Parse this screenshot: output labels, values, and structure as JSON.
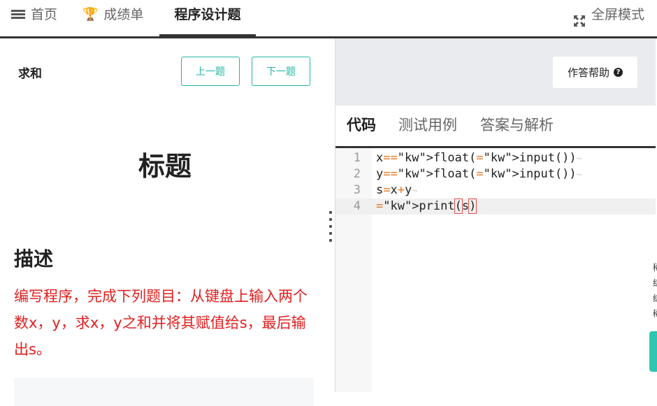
{
  "nav": {
    "home": "首页",
    "grades": "成绩单",
    "active": "程序设计题",
    "fullscreen": "全屏模式"
  },
  "problem": {
    "name": "求和",
    "prev": "上一题",
    "next": "下一题",
    "title": "标题",
    "desc_heading": "描述",
    "desc_text": "编写程序，完成下列题目：从键盘上输入两个数x，y，求x，y之和并将其赋值给s，最后输出s。"
  },
  "help": {
    "label": "作答帮助"
  },
  "tabs": [
    "代码",
    "测试用例",
    "答案与解析"
  ],
  "editor": {
    "lines": [
      {
        "num": "1",
        "text": "x=float(input())"
      },
      {
        "num": "2",
        "text": "y=float(input())"
      },
      {
        "num": "3",
        "text": "s=x+y"
      },
      {
        "num": "4",
        "text": "print(s)"
      }
    ]
  },
  "colors": {
    "accent": "#24b6a2",
    "desc": "#e02020",
    "keyword": "#e0761f"
  }
}
